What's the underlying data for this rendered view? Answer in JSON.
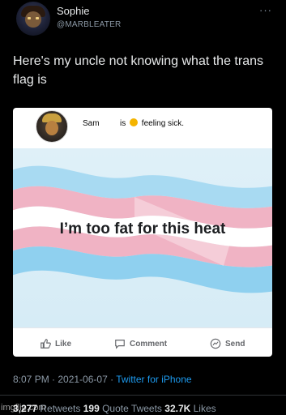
{
  "tweet": {
    "author_name": "Sophie",
    "author_handle": "@MARBLEATER",
    "more_label": "···",
    "text": "Here's my uncle not knowing what the trans flag is",
    "timestamp": "8:07 PM · 2021-06-07 · ",
    "source": "Twitter for iPhone",
    "stats": {
      "retweets_count": "3,277",
      "retweets_label": " Retweets ",
      "quotes_count": "199",
      "quotes_label": " Quote Tweets ",
      "likes_count": "32.7K",
      "likes_label": " Likes"
    }
  },
  "facebook_post": {
    "author_name": "Sam",
    "status_prefix": "is",
    "status_text": "feeling sick.",
    "caption": "I’m too fat for this heat",
    "actions": {
      "like": "Like",
      "comment": "Comment",
      "send": "Send"
    }
  },
  "watermark": "imgflip.com",
  "colors": {
    "background": "#000000",
    "link": "#1d9bf0",
    "flag_blue": "#8fd0ef",
    "flag_pink": "#f0b3c4",
    "flag_white": "#ffffff"
  }
}
